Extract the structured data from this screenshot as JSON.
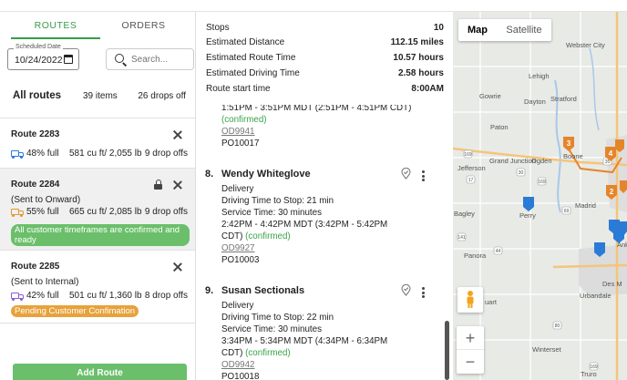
{
  "tabs": {
    "routes": "ROUTES",
    "orders": "ORDERS"
  },
  "filters": {
    "date_label": "Scheduled Date",
    "date_value": "10/24/2022",
    "search_placeholder": "Search..."
  },
  "all_routes": {
    "title": "All routes",
    "items": "39 items",
    "drops": "26 drops off"
  },
  "routes": [
    {
      "name": "Route 2283",
      "status": "",
      "pct": "48% full",
      "cuft": "581 cu ft/ 2,055 lb",
      "drops": "9 drop offs",
      "badge": ""
    },
    {
      "name": "Route 2284",
      "status": "(Sent to Onward)",
      "pct": "55% full",
      "cuft": "665 cu ft/ 2,085 lb",
      "drops": "9 drop offs",
      "badge": "All customer timeframes are confirmed and ready"
    },
    {
      "name": "Route 2285",
      "status": "(Sent to Internal)",
      "pct": "42% full",
      "cuft": "501 cu ft/ 1,360 lb",
      "drops": "8 drop offs",
      "badge": "Pending Customer Confimation"
    }
  ],
  "add_route_label": "Add Route",
  "summary": [
    {
      "label": "Stops",
      "value": "10"
    },
    {
      "label": "Estimated Distance",
      "value": "112.15 miles"
    },
    {
      "label": "Estimated Route Time",
      "value": "10.57 hours"
    },
    {
      "label": "Estimated Driving Time",
      "value": "2.58 hours"
    },
    {
      "label": "Route start time",
      "value": "8:00AM"
    }
  ],
  "prev_stop": {
    "time_fragment": "1:51PM - 3:51PM MDT (2:51PM - 4:51PM CDT)",
    "confirmed": "(confirmed)",
    "order": "OD9941",
    "po": "PO10017"
  },
  "stops": [
    {
      "num": "8.",
      "name": "Wendy Whiteglove",
      "type": "Delivery",
      "driving": "Driving Time to Stop: 21 min",
      "service": "Service Time: 30 minutes",
      "time1": "2:42PM - 4:42PM MDT (3:42PM - 5:42PM",
      "time2": "CDT)",
      "confirmed": "(confirmed)",
      "order": "OD9927",
      "po": "PO10003"
    },
    {
      "num": "9.",
      "name": "Susan Sectionals",
      "type": "Delivery",
      "driving": "Driving Time to Stop: 22 min",
      "service": "Service Time: 30 minutes",
      "time1": "3:34PM - 5:34PM MDT (4:34PM - 6:34PM",
      "time2": "CDT)",
      "confirmed": "(confirmed)",
      "order": "OD9942",
      "po": "PO10018"
    }
  ],
  "map": {
    "type_map": "Map",
    "type_satellite": "Satellite",
    "zoom_in": "+",
    "zoom_out": "−",
    "towns": [
      "Webster City",
      "Lehigh",
      "Gowrie",
      "Dayton",
      "Stratford",
      "Paton",
      "Boone",
      "Grand Junction",
      "Jefferson",
      "Ogden",
      "Madrid",
      "Perry",
      "Bagley",
      "Panora",
      "Urbandale",
      "Des M",
      "Ank",
      "uart",
      "Winterset",
      "Truro"
    ],
    "markers": [
      "3",
      "4",
      "2"
    ],
    "route_shields": [
      "169",
      "30",
      "17",
      "141",
      "169",
      "69",
      "44",
      "80",
      "35",
      "169"
    ],
    "colors": {
      "accent": "#3a9a4a",
      "route_marker": "#e5852a",
      "stop_marker": "#2a7bd6"
    }
  }
}
